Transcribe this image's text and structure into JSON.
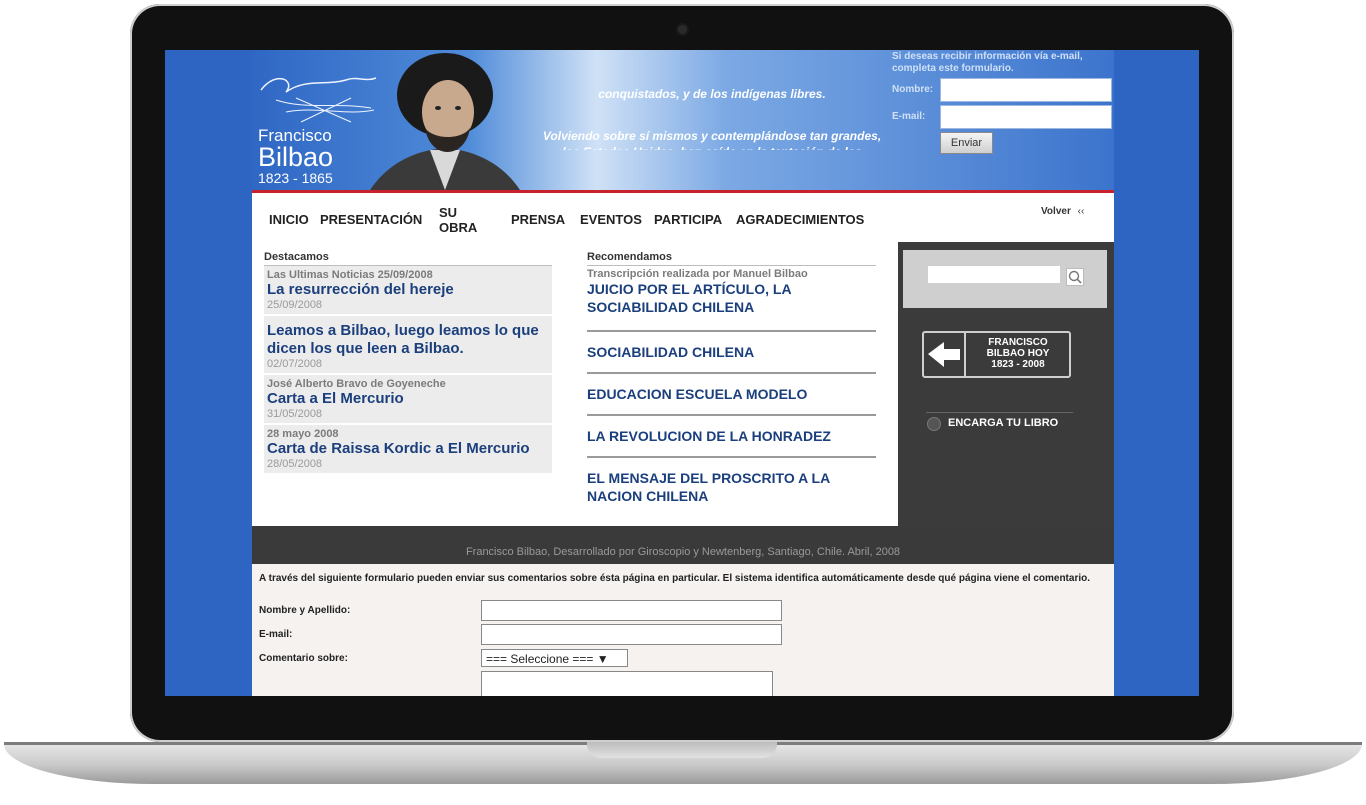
{
  "header": {
    "site_first_name": "Francisco",
    "site_last_name": "Bilbao",
    "site_years": "1823 - 1865",
    "quote_line1": "conquistados, y de los indígenas libres.",
    "quote_line2": "Volviendo sobre sí mismos y contemplándose tan grandes, los Estados Unidos, han caído en la tentación de los"
  },
  "newsletter": {
    "info": "Si deseas recibir información vía e-mail, completa este formulario.",
    "name_label": "Nombre:",
    "email_label": "E-mail:",
    "submit_label": "Enviar"
  },
  "nav": {
    "items": [
      "INICIO",
      "PRESENTACIÓN",
      "SU OBRA",
      "PRENSA",
      "EVENTOS",
      "PARTICIPA",
      "AGRADECIMIENTOS"
    ],
    "back_label": "Volver",
    "back_icon": "‹‹"
  },
  "destacamos": {
    "title": "Destacamos",
    "items": [
      {
        "source": "Las Ultimas Noticias 25/09/2008",
        "title": "La resurrección del hereje",
        "date": "25/09/2008"
      },
      {
        "source": "",
        "title": "Leamos a Bilbao, luego leamos lo que dicen los que leen a Bilbao.",
        "date": "02/07/2008"
      },
      {
        "source": "José Alberto Bravo de Goyeneche",
        "title": "Carta a El Mercurio",
        "date": "31/05/2008"
      },
      {
        "source": "28 mayo 2008",
        "title": "Carta de Raissa Kordic a El Mercurio",
        "date": "28/05/2008"
      }
    ]
  },
  "recomendamos": {
    "title": "Recomendamos",
    "subtitle": "Transcripción realizada por Manuel Bilbao",
    "items": [
      "JUICIO POR EL ARTÍCULO, LA SOCIABILIDAD CHILENA",
      "SOCIABILIDAD CHILENA",
      "EDUCACION ESCUELA MODELO",
      "LA REVOLUCION DE LA HONRADEZ",
      "EL MENSAJE DEL PROSCRITO A LA NACION CHILENA"
    ]
  },
  "sidebar": {
    "promo_line1": "FRANCISCO",
    "promo_line2": "BILBAO HOY",
    "promo_line3": "1823 - 2008",
    "encarga_label": "ENCARGA TU LIBRO"
  },
  "footer": {
    "text": "Francisco Bilbao, Desarrollado por Giroscopio y Newtenberg, Santiago, Chile. Abril, 2008"
  },
  "comment_form": {
    "intro": "A través del siguiente formulario pueden enviar sus comentarios sobre ésta página en particular. El sistema identifica automáticamente desde qué página viene el comentario.",
    "name_label": "Nombre y Apellido:",
    "email_label": "E-mail:",
    "topic_label": "Comentario sobre:",
    "topic_selected": "=== Seleccione === ▼"
  },
  "colors": {
    "site_blue": "#2e64c2",
    "link_blue": "#1b3f7d",
    "accent_red": "#c8202c",
    "sidebar_dark": "#3b3b3b"
  }
}
